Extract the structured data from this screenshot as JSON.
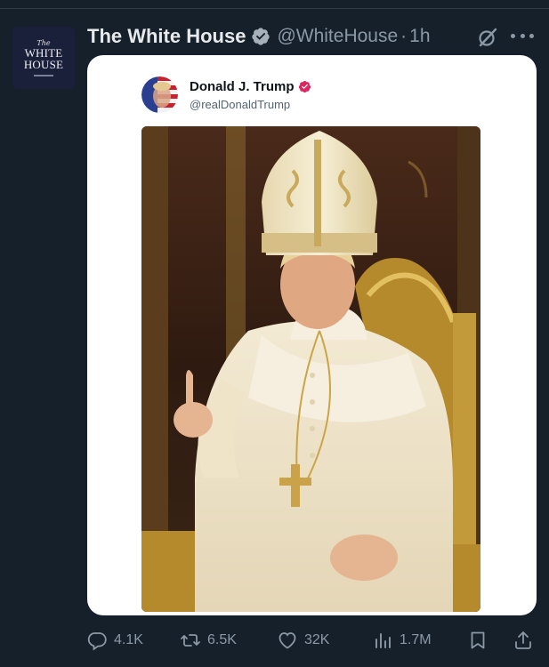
{
  "colors": {
    "background": "#15202b",
    "card": "#ffffff",
    "muted": "#8b98a5",
    "verified_blue": "#1d9bf0",
    "verified_pink": "#e0245e"
  },
  "tweet": {
    "avatar_text_top": "The",
    "avatar_text_main_1": "WHITE",
    "avatar_text_main_2": "HOUSE",
    "author_name": "The White House",
    "author_handle": "@WhiteHouse",
    "separator": "·",
    "time": "1h",
    "grok_icon": "grok-icon",
    "more_icon": "more-icon"
  },
  "embedded": {
    "author_name": "Donald J. Trump",
    "author_handle": "@realDonaldTrump"
  },
  "actions": {
    "replies": "4.1K",
    "reposts": "6.5K",
    "likes": "32K",
    "views": "1.7M"
  }
}
